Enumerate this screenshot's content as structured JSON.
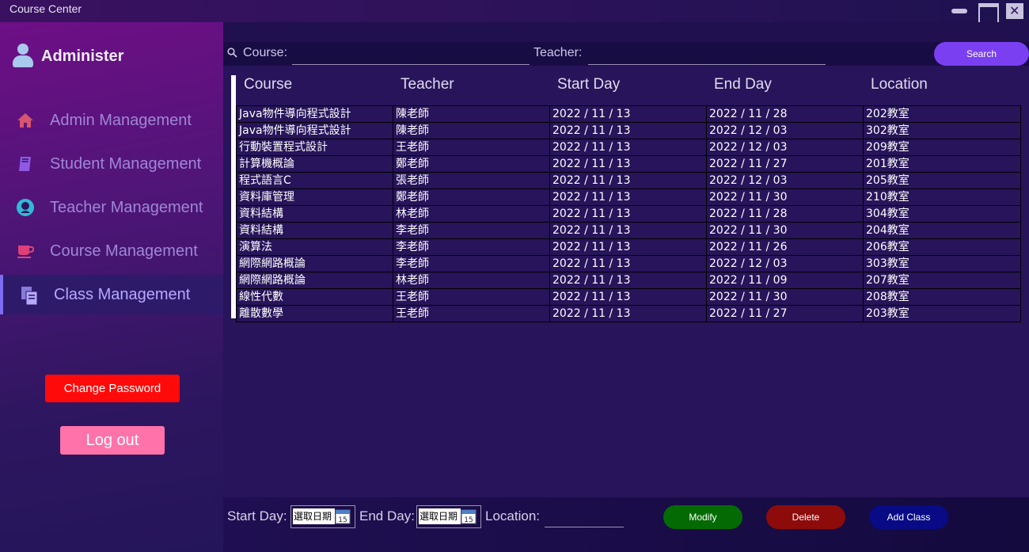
{
  "window": {
    "title": "Course Center"
  },
  "sidebar": {
    "user": "Administer",
    "items": [
      {
        "label": "Admin Management",
        "icon": "home-icon",
        "active": false
      },
      {
        "label": "Student Management",
        "icon": "book-icon",
        "active": false
      },
      {
        "label": "Teacher Management",
        "icon": "person-circle-icon",
        "active": false
      },
      {
        "label": "Course Management",
        "icon": "coffee-cup-icon",
        "active": false
      },
      {
        "label": "Class Management",
        "icon": "copy-document-icon",
        "active": true
      }
    ],
    "change_password": "Change Password",
    "logout": "Log out"
  },
  "search": {
    "course_label": "Course:",
    "teacher_label": "Teacher:",
    "course_value": "",
    "teacher_value": "",
    "button": "Search"
  },
  "table": {
    "headers": [
      "Course",
      "Teacher",
      "Start Day",
      "End Day",
      "Location"
    ],
    "rows": [
      [
        "Java物件導向程式設計",
        "陳老師",
        "2022 / 11 / 13",
        "2022 / 11 / 28",
        "202教室"
      ],
      [
        "Java物件導向程式設計",
        "陳老師",
        "2022 / 11 / 13",
        "2022 / 12 / 03",
        "302教室"
      ],
      [
        "行動裝置程式設計",
        "王老師",
        "2022 / 11 / 13",
        "2022 / 12 / 03",
        "209教室"
      ],
      [
        "計算機概論",
        "鄭老師",
        "2022 / 11 / 13",
        "2022 / 11 / 27",
        "201教室"
      ],
      [
        "程式語言C",
        "張老師",
        "2022 / 11 / 13",
        "2022 / 12 / 03",
        "205教室"
      ],
      [
        "資料庫管理",
        "鄭老師",
        "2022 / 11 / 13",
        "2022 / 11 / 30",
        "210教室"
      ],
      [
        "資料結構",
        "林老師",
        "2022 / 11 / 13",
        "2022 / 11 / 28",
        "304教室"
      ],
      [
        "資料結構",
        "李老師",
        "2022 / 11 / 13",
        "2022 / 11 / 30",
        "204教室"
      ],
      [
        "演算法",
        "李老師",
        "2022 / 11 / 13",
        "2022 / 11 / 26",
        "206教室"
      ],
      [
        "網際網路概論",
        "李老師",
        "2022 / 11 / 13",
        "2022 / 12 / 03",
        "303教室"
      ],
      [
        "網際網路概論",
        "林老師",
        "2022 / 11 / 13",
        "2022 / 11 / 09",
        "207教室"
      ],
      [
        "線性代數",
        "王老師",
        "2022 / 11 / 13",
        "2022 / 11 / 30",
        "208教室"
      ],
      [
        "離散數學",
        "王老師",
        "2022 / 11 / 13",
        "2022 / 11 / 27",
        "203教室"
      ]
    ]
  },
  "form": {
    "start_label": "Start Day:",
    "end_label": "End Day:",
    "location_label": "Location:",
    "start_placeholder": "選取日期",
    "end_placeholder": "選取日期",
    "calendar_day": "15",
    "location_value": "",
    "modify": "Modify",
    "delete": "Delete",
    "add": "Add Class"
  },
  "colors": {
    "accent": "#7b3ff2",
    "modify": "#046b04",
    "delete": "#8e0b0b",
    "add": "#080b85",
    "change_password": "#ff0a0a",
    "logout": "#ff72aa"
  }
}
